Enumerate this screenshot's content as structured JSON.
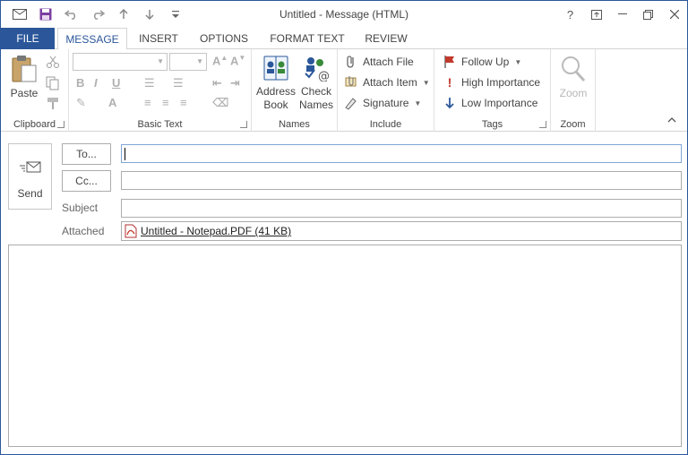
{
  "window": {
    "title": "Untitled - Message (HTML)"
  },
  "quick_access": [
    "mail-icon",
    "save-icon",
    "undo-icon",
    "redo-icon",
    "up-arrow-icon",
    "down-arrow-icon",
    "customize-icon"
  ],
  "window_controls": {
    "help": "?"
  },
  "tabs": [
    {
      "label": "FILE"
    },
    {
      "label": "MESSAGE"
    },
    {
      "label": "INSERT"
    },
    {
      "label": "OPTIONS"
    },
    {
      "label": "FORMAT TEXT"
    },
    {
      "label": "REVIEW"
    }
  ],
  "ribbon": {
    "clipboard": {
      "label": "Clipboard",
      "paste": "Paste"
    },
    "basic_text": {
      "label": "Basic Text"
    },
    "names": {
      "label": "Names",
      "address_book_1": "Address",
      "address_book_2": "Book",
      "check_names_1": "Check",
      "check_names_2": "Names"
    },
    "include": {
      "label": "Include",
      "attach_file": "Attach File",
      "attach_item": "Attach Item",
      "signature": "Signature"
    },
    "tags": {
      "label": "Tags",
      "follow_up": "Follow Up",
      "high_importance": "High Importance",
      "low_importance": "Low Importance"
    },
    "zoom": {
      "label": "Zoom",
      "zoom": "Zoom"
    }
  },
  "compose": {
    "send": "Send",
    "to_button": "To...",
    "cc_button": "Cc...",
    "subject_label": "Subject",
    "attached_label": "Attached",
    "attachment": "Untitled - Notepad.PDF (41 KB)",
    "to_value": "",
    "cc_value": "",
    "subject_value": ""
  },
  "colors": {
    "accent": "#2b579a",
    "follow_up_flag": "#c0392b",
    "high_importance": "#c0392b",
    "low_importance": "#2b579a"
  }
}
